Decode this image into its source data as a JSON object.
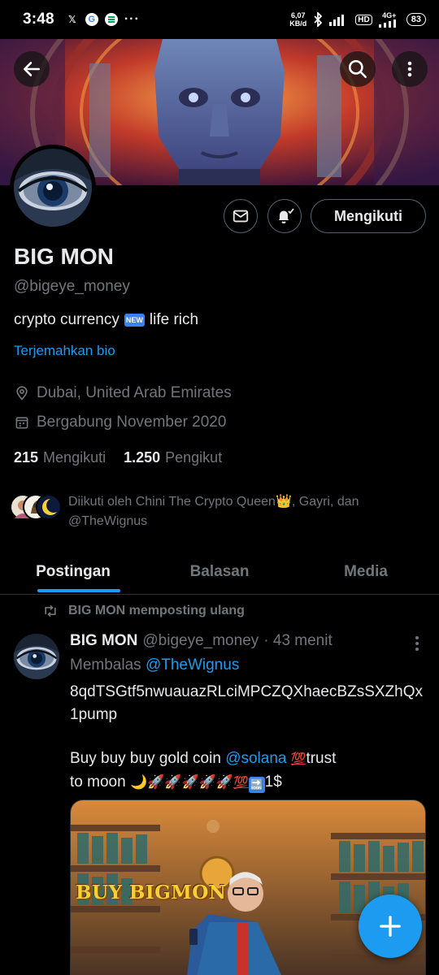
{
  "status_bar": {
    "time": "3:48",
    "app_x": "𝕏",
    "app_g": "G",
    "more": "···",
    "speed_value": "6,07",
    "speed_unit": "KB/d",
    "hd": "HD",
    "network": "4G+",
    "battery": "83"
  },
  "header": {
    "back_icon": "arrow-left-icon",
    "search_icon": "search-icon",
    "more_icon": "more-vertical-icon"
  },
  "profile": {
    "name": "BIG MON",
    "handle": "@bigeye_money",
    "bio_before": "crypto currency",
    "bio_badge": "NEW",
    "bio_after": "life rich",
    "translate_bio": "Terjemahkan bio",
    "location": "Dubai, United Arab Emirates",
    "joined": "Bergabung November 2020",
    "following_count": "215",
    "following_label": "Mengikuti",
    "followers_count": "1.250",
    "followers_label": "Pengikut",
    "followed_by": "Diikuti oleh Chini The Crypto Queen👑, Gayri, dan @TheWignus",
    "follow_button": "Mengikuti"
  },
  "tabs": [
    {
      "label": "Postingan",
      "active": true
    },
    {
      "label": "Balasan",
      "active": false
    },
    {
      "label": "Media",
      "active": false
    }
  ],
  "post": {
    "repost_label": "BIG MON memposting ulang",
    "author_name": "BIG MON",
    "author_handle": "@bigeye_money",
    "time": "· 43 menit",
    "reply_prefix": "Membalas",
    "reply_to": "@TheWignus",
    "contract": "8qdTSGtf5nwuauazRLciMPCZQXhaecBZsSXZhQx1pump",
    "line2_start": "Buy buy buy gold coin",
    "mention": "@solana",
    "hundred": "💯",
    "line2_end": "trust",
    "line3_start": "to moon",
    "line3_emojis": "🌙🚀🚀🚀🚀🚀",
    "line3_soon": "🔜",
    "line3_end": "1$",
    "image_caption": "BUY BIGMON"
  },
  "colors": {
    "accent": "#1d9bf0",
    "background": "#000000",
    "secondary_text": "#71767b",
    "divider": "#2f3336"
  }
}
